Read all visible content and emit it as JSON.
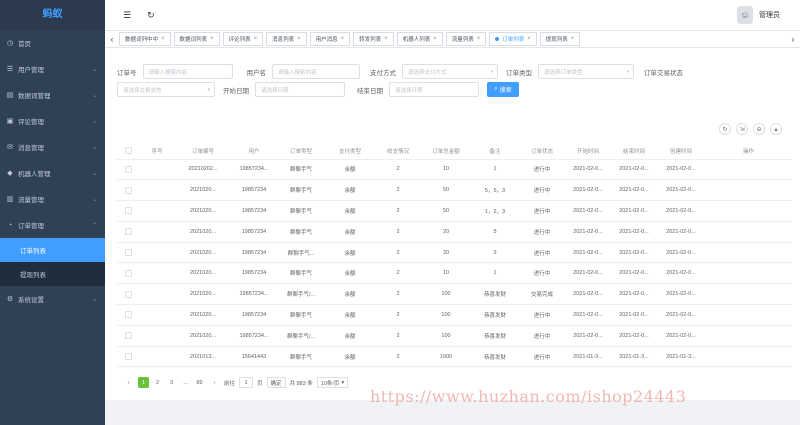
{
  "sidebar": {
    "logo": "蚂蚁",
    "items": [
      {
        "label": "首页",
        "icon": "dashboard-icon"
      },
      {
        "label": "用户管理",
        "icon": "user-icon"
      },
      {
        "label": "数据词管理",
        "icon": "list-icon"
      },
      {
        "label": "评论管理",
        "icon": "comment-icon"
      },
      {
        "label": "消息管理",
        "icon": "message-icon"
      },
      {
        "label": "机器人管理",
        "icon": "robot-icon"
      },
      {
        "label": "流量管理",
        "icon": "chart-icon"
      },
      {
        "label": "订单管理",
        "icon": "order-icon"
      }
    ],
    "submenu": [
      {
        "label": "订单列表"
      },
      {
        "label": "提现列表"
      }
    ],
    "last_item": {
      "label": "系统设置",
      "icon": "gear-icon"
    }
  },
  "header": {
    "user_name": "管理员",
    "avatar_glyph": "☺"
  },
  "tabs": [
    {
      "label": "数据词列中中"
    },
    {
      "label": "数据词列表"
    },
    {
      "label": "评论列表"
    },
    {
      "label": "消息列表"
    },
    {
      "label": "用户消息"
    },
    {
      "label": "转发列表"
    },
    {
      "label": "机器人列表"
    },
    {
      "label": "流量列表"
    },
    {
      "label": "订单列表"
    },
    {
      "label": "提现列表"
    }
  ],
  "filters": {
    "order_no_label": "订单号",
    "order_no_placeholder": "请输入搜索内容",
    "user_label": "用户名",
    "user_placeholder": "请输入搜索内容",
    "pay_label": "支付方式",
    "pay_placeholder": "请选择支付方式",
    "order_type_label": "订单类型",
    "order_type_placeholder": "请选择订单类型",
    "trade_status_label": "订单交易状态",
    "trade_status_placeholder": "请选择交易状态",
    "start_label": "开始日期",
    "start_placeholder": "请选择日期",
    "end_label": "结束日期",
    "end_placeholder": "请选择日期",
    "search_label": "搜索"
  },
  "table": {
    "headers": [
      "序号",
      "订单编号",
      "用户",
      "订单类型",
      "支付类型",
      "收支情况",
      "订单总金额",
      "备注",
      "订单状态",
      "开始时间",
      "结束时间",
      "创建时间",
      "操作"
    ],
    "rows": [
      [
        "",
        "20210202...",
        "19857234...",
        "群聊手气",
        "余额",
        "2",
        "10",
        "1",
        "进行中",
        "2021-02-0...",
        "2021-02-0...",
        "2021-02-0...",
        ""
      ],
      [
        "",
        "2021020...",
        "19857234",
        "群聊手气",
        "余额",
        "2",
        "50",
        "5，5，3",
        "进行中",
        "2021-02-0...",
        "2021-02-0...",
        "2021-02-0...",
        ""
      ],
      [
        "",
        "2021020...",
        "19857234",
        "群聊手气",
        "余额",
        "2",
        "50",
        "1，2，3",
        "进行中",
        "2021-02-0...",
        "2021-02-0...",
        "2021-02-0...",
        ""
      ],
      [
        "",
        "2021020...",
        "19857234",
        "群聊手气",
        "余额",
        "2",
        "20",
        "5",
        "进行中",
        "2021-02-0...",
        "2021-02-0...",
        "2021-02-0...",
        ""
      ],
      [
        "",
        "2021020...",
        "19857234",
        "群聊手气...",
        "余额",
        "2",
        "20",
        "3",
        "进行中",
        "2021-02-0...",
        "2021-02-0...",
        "2021-02-0...",
        ""
      ],
      [
        "",
        "2021020...",
        "19857234",
        "群聊手气",
        "余额",
        "2",
        "10",
        "1",
        "进行中",
        "2021-02-0...",
        "2021-02-0...",
        "2021-02-0...",
        ""
      ],
      [
        "",
        "2021020...",
        "19857234...",
        "群聊手气/...",
        "余额",
        "2",
        "100",
        "恭喜发财",
        "交易完成",
        "2021-02-0...",
        "2021-02-0...",
        "2021-02-0...",
        ""
      ],
      [
        "",
        "2021020...",
        "19857234",
        "群聊手气",
        "余额",
        "2",
        "100",
        "恭喜发财",
        "进行中",
        "2021-02-0...",
        "2021-02-0...",
        "2021-02-0...",
        ""
      ],
      [
        "",
        "2021020...",
        "19857234...",
        "群聊手气/...",
        "余额",
        "2",
        "100",
        "恭喜发财",
        "进行中",
        "2021-02-0...",
        "2021-02-0...",
        "2021-02-0...",
        ""
      ],
      [
        "",
        "2021013...",
        "15641443",
        "群聊手气",
        "余额",
        "2",
        "1000",
        "恭喜发财",
        "进行中",
        "2021-01-3...",
        "2021-01-3...",
        "2021-01-3...",
        ""
      ]
    ]
  },
  "pager": {
    "prev": "‹",
    "pages": [
      "1",
      "2",
      "3",
      "...",
      "89"
    ],
    "next": "›",
    "goto_label": "前往",
    "goto_value": "1",
    "page_unit": "页",
    "go_label": "确定",
    "total": "共 883 条",
    "size": "10条/页"
  },
  "watermark": "https://www.huzhan.com/ishop24443"
}
